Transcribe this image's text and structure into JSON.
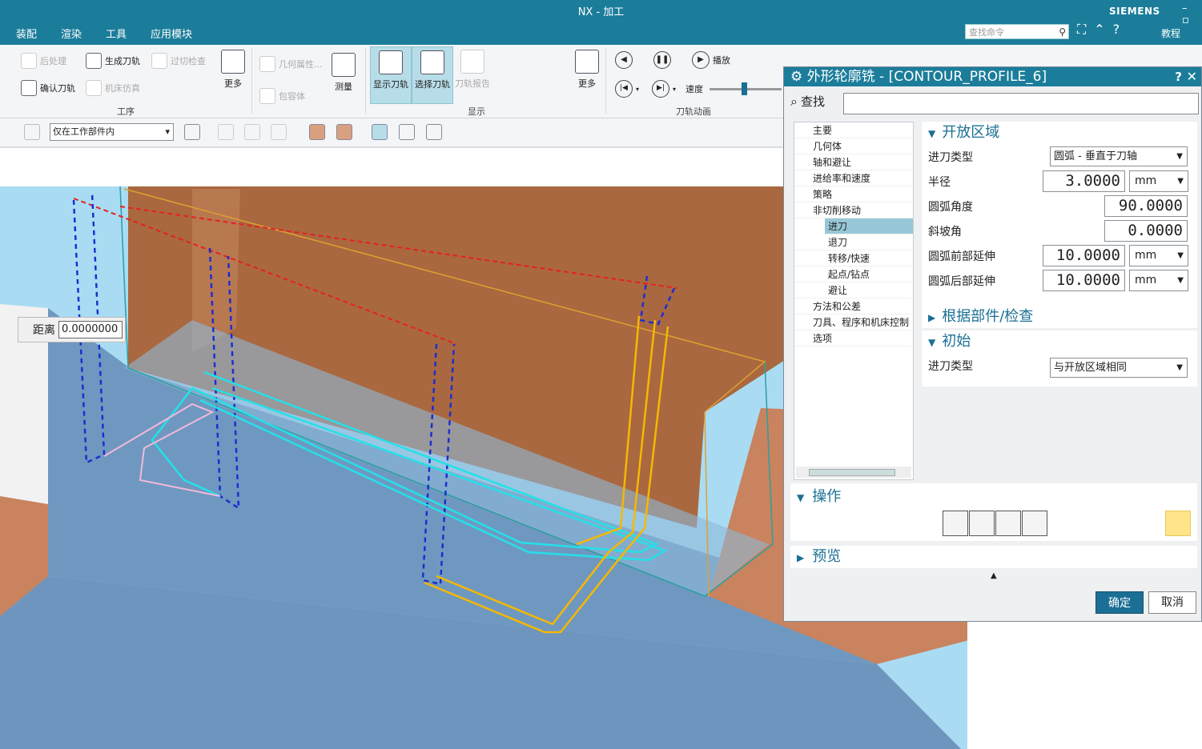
{
  "app": {
    "title": "NX - 加工",
    "brand": "SIEMENS",
    "menu": [
      "装配",
      "渲染",
      "工具",
      "应用模块"
    ],
    "search_placeholder": "查找命令",
    "tutorial": "教程"
  },
  "ribbon": {
    "gongxu": {
      "items": [
        "后处理",
        "生成刀轨",
        "过切检查",
        "确认刀轨",
        "机床仿真"
      ],
      "more": "更多",
      "group": "工序"
    },
    "misc": {
      "geometry_props": "几何属性...",
      "bounding_body": "包容体",
      "measure": "测量"
    },
    "display": {
      "show_path": "显示刀轨",
      "select_path": "选择刀轨",
      "path_report": "刀轨报告",
      "more": "更多",
      "group": "显示"
    },
    "animation": {
      "play": "播放",
      "speed": "速度",
      "group": "刀轨动画"
    }
  },
  "filter": {
    "scope": "仅在工作部件内"
  },
  "distance_box": {
    "label": "距离",
    "value": "0.0000000"
  },
  "dialog": {
    "title": "外形轮廓铣 - [CONTOUR_PROFILE_6]",
    "find_label": "查找",
    "tree": [
      "主要",
      "几何体",
      "轴和避让",
      "进给率和速度",
      "策略",
      "非切削移动",
      "进刀",
      "退刀",
      "转移/快速",
      "起点/钻点",
      "避让",
      "方法和公差",
      "刀具、程序和机床控制",
      "选项"
    ],
    "open_area": {
      "header": "开放区域",
      "entry_type_label": "进刀类型",
      "entry_type": "圆弧 - 垂直于刀轴",
      "radius_label": "半径",
      "radius": "3.0000",
      "radius_unit": "mm",
      "arc_angle_label": "圆弧角度",
      "arc_angle": "90.0000",
      "ramp_angle_label": "斜坡角",
      "ramp_angle": "0.0000",
      "arc_front_label": "圆弧前部延伸",
      "arc_front": "10.0000",
      "arc_front_unit": "mm",
      "arc_back_label": "圆弧后部延伸",
      "arc_back": "10.0000",
      "arc_back_unit": "mm"
    },
    "check_header": "根据部件/检查",
    "initial": {
      "header": "初始",
      "entry_type_label": "进刀类型",
      "entry_type": "与开放区域相同"
    },
    "ops_header": "操作",
    "preview_header": "预览",
    "ok": "确定",
    "cancel": "取消"
  }
}
